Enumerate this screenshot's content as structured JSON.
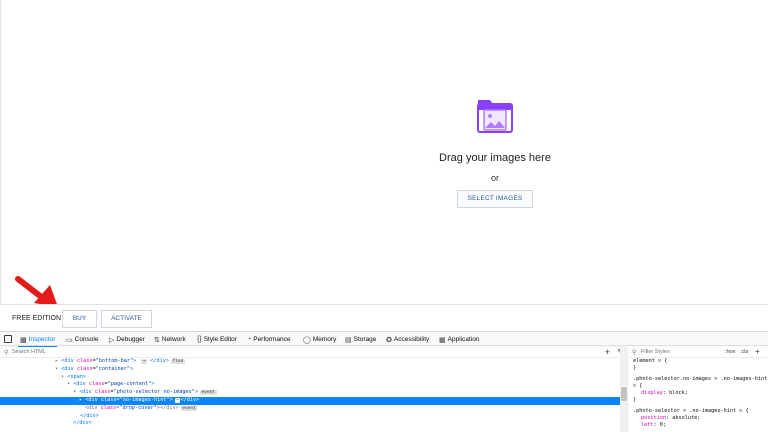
{
  "drop_zone": {
    "title": "Drag your images here",
    "or_text": "or",
    "select_button": "SELECT IMAGES",
    "icon": "image-folder-icon",
    "accent_color": "#8a3ffc"
  },
  "bottom_bar": {
    "edition_label": "FREE EDITION",
    "buy_button": "BUY",
    "activate_button": "ACTIVATE"
  },
  "devtools": {
    "tabs": [
      {
        "label": "Inspector",
        "icon": "inspector-icon"
      },
      {
        "label": "Console",
        "icon": "console-icon"
      },
      {
        "label": "Debugger",
        "icon": "debugger-icon"
      },
      {
        "label": "Network",
        "icon": "network-icon"
      },
      {
        "label": "Style Editor",
        "icon": "style-editor-icon"
      },
      {
        "label": "Performance",
        "icon": "performance-icon"
      },
      {
        "label": "Memory",
        "icon": "memory-icon"
      },
      {
        "label": "Storage",
        "icon": "storage-icon"
      },
      {
        "label": "Accessibility",
        "icon": "accessibility-icon"
      },
      {
        "label": "Application",
        "icon": "application-icon"
      }
    ],
    "active_tab": "Inspector",
    "search_placeholder": "Search HTML",
    "markup": {
      "l1": {
        "tag_open": "<div",
        "attr": "class",
        "val": "\"bottom-bar\"",
        "rest": "> ",
        "badge_dots": "⋯",
        "close": "</div>",
        "badge": "flex"
      },
      "l2": {
        "tag_open": "<div",
        "attr": "class",
        "val": "\"container\"",
        "rest": ">"
      },
      "l3": {
        "tag": "<span>"
      },
      "l4": {
        "tag_open": "<div",
        "attr": "class",
        "val": "\"page-content\"",
        "rest": ">"
      },
      "l5": {
        "tag_open": "<div",
        "attr": "class",
        "val": "\"photo-selector no-images\"",
        "rest": ">",
        "badge": "event"
      },
      "l6": {
        "tag_open": "<div",
        "attr": "class",
        "val": "\"no-images-hint\"",
        "rest": ">",
        "badge_dots": "⋯",
        "close": "</div>"
      },
      "l7": {
        "tag_open": "<div",
        "attr": "class",
        "val": "\"drop-cover\"",
        "rest": "></div>",
        "badge": "event"
      },
      "l8": {
        "tag": "</div>"
      },
      "l9": {
        "tag": "</div>"
      }
    },
    "filter_placeholder": "Filter Styles",
    "hov_label": ":hov",
    "cls_label": ".cls",
    "rules": {
      "r1": "element",
      "r1_open": "{",
      "r1_close": "}",
      "r2_selector": ".photo-selector.no-images > .no-images-hint",
      "r2_open": "{",
      "r2_prop": "display",
      "r2_val": "block;",
      "r2_close": "}",
      "r3_selector": ".photo-selector > .no-images-hint",
      "r3_open": "{",
      "r3_prop1": "position",
      "r3_val1": "absolute;",
      "r3_prop2": "left",
      "r3_val2": "0;"
    }
  }
}
